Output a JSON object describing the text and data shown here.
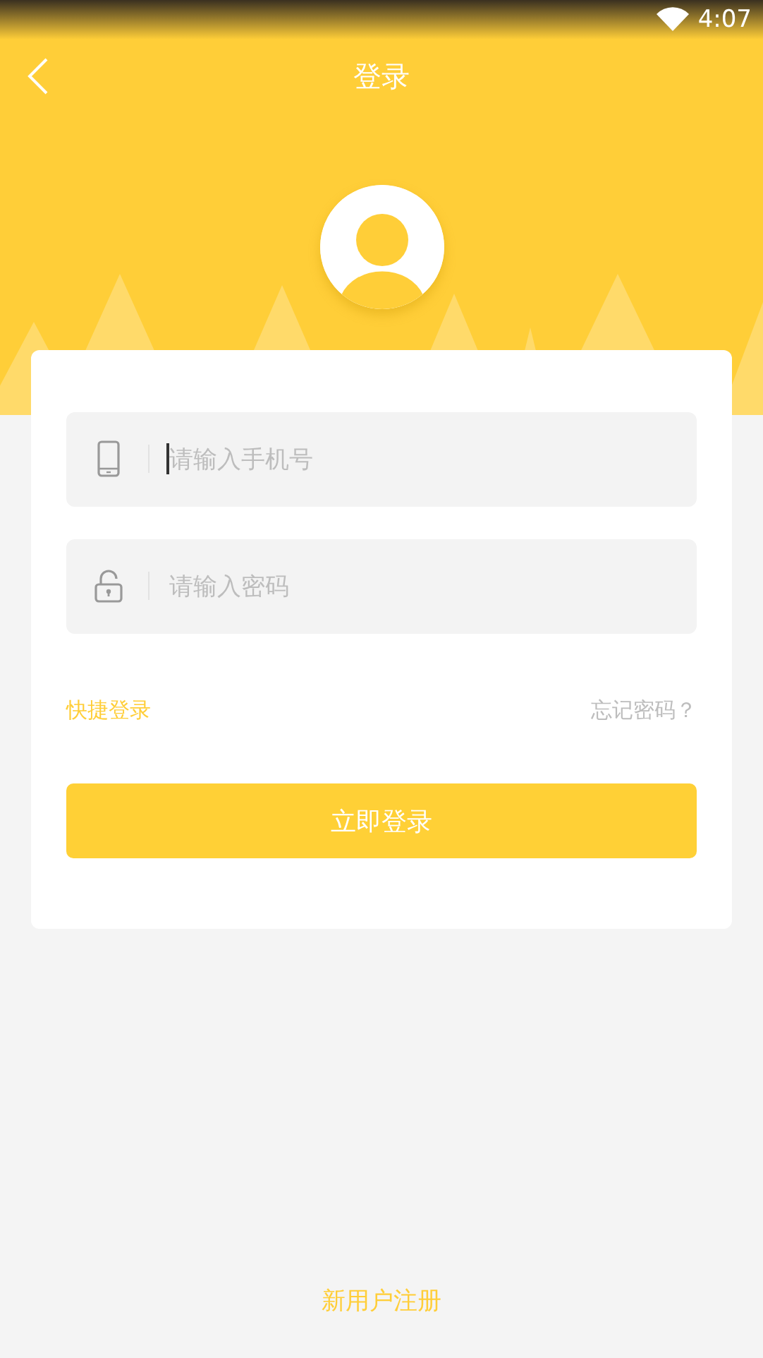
{
  "status_bar": {
    "time": "4:07"
  },
  "nav": {
    "title": "登录"
  },
  "fields": [
    {
      "kind": "phone",
      "placeholder": "请输入手机号",
      "focused": true
    },
    {
      "kind": "password",
      "placeholder": "请输入密码",
      "focused": false
    }
  ],
  "links": {
    "quick_login": "快捷登录",
    "forgot_password": "忘记密码？"
  },
  "login_button": "立即登录",
  "register_link": "新用户注册"
}
